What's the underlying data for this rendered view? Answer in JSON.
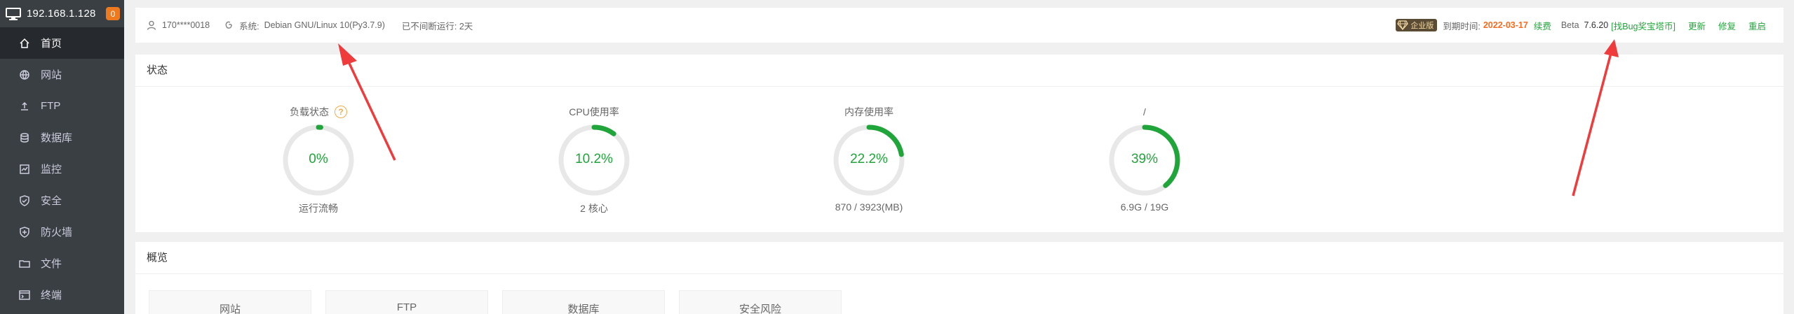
{
  "sidebar": {
    "host_ip": "192.168.1.128",
    "badge_count": "0",
    "items": [
      {
        "label": "首页",
        "icon": "home-icon",
        "active": true
      },
      {
        "label": "网站",
        "icon": "globe-icon"
      },
      {
        "label": "FTP",
        "icon": "upload-icon"
      },
      {
        "label": "数据库",
        "icon": "database-icon"
      },
      {
        "label": "监控",
        "icon": "monitor-icon"
      },
      {
        "label": "安全",
        "icon": "shield-icon"
      },
      {
        "label": "防火墙",
        "icon": "firewall-icon"
      },
      {
        "label": "文件",
        "icon": "folder-icon"
      },
      {
        "label": "终端",
        "icon": "terminal-icon"
      }
    ]
  },
  "topbar": {
    "user": "170****0018",
    "system_label": "系统:",
    "system_value": "Debian GNU/Linux 10(Py3.7.9)",
    "uptime": "已不间断运行: 2天",
    "edition_badge": "企业版",
    "expire_label": "到期时间:",
    "expire_date": "2022-03-17",
    "renew": "续费",
    "version_prefix": "Beta",
    "version": "7.6.20",
    "bug_bounty": "[找Bug奖宝塔币]",
    "update": "更新",
    "repair": "修复",
    "restart": "重启"
  },
  "status_panel": {
    "title": "状态",
    "gauges": [
      {
        "title": "负载状态",
        "value": "0%",
        "sub": "运行流畅",
        "percent": 0,
        "has_help": true
      },
      {
        "title": "CPU使用率",
        "value": "10.2%",
        "sub": "2 核心",
        "percent": 10.2
      },
      {
        "title": "内存使用率",
        "value": "22.2%",
        "sub": "870 / 3923(MB)",
        "percent": 22.2
      },
      {
        "title": "/",
        "value": "39%",
        "sub": "6.9G / 19G",
        "percent": 39
      }
    ],
    "help_symbol": "?"
  },
  "overview_panel": {
    "title": "概览",
    "cards": [
      "网站",
      "FTP",
      "数据库",
      "安全风险"
    ]
  },
  "colors": {
    "sidebar_bg": "#3a3f44",
    "accent_green": "#20a53a",
    "ring_track": "#e8e8e8",
    "expire_orange": "#fb6a1e",
    "annotation_red": "#ef3b3b"
  }
}
